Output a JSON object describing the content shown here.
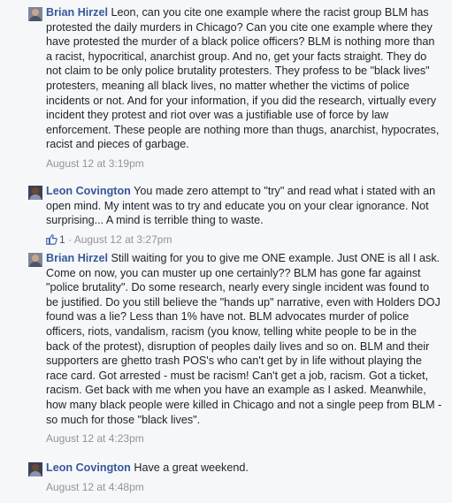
{
  "comments": [
    {
      "author": "Brian Hirzel",
      "text": "Leon, can you cite one example where the racist group BLM has protested the daily murders in Chicago? Can you cite one example where they have protested the murder of a black police officers? BLM is nothing more than a racist, hypocritical, anarchist group. And no, get your facts straight. They do not claim to be only police brutality protesters. They profess to be \"black lives\" protesters, meaning all black lives, no matter whether the victims of police incidents or not. And for your information, if you did the research, virtually every incident they protest and riot over was a justifiable use of force by law enforcement. These people are nothing more than thugs, anarchist, hypocrates, racist and pieces of garbage.",
      "timestamp": "August 12 at 3:19pm"
    },
    {
      "author": "Leon Covington",
      "text": "You made zero attempt to \"try\" and read what i stated with an open mind. My intent was to try and educate you on your clear ignorance. Not surprising... A mind is terrible thing to waste.",
      "likes": "1",
      "separator": " · ",
      "timestamp": "August 12 at 3:27pm"
    },
    {
      "author": "Brian Hirzel",
      "text": "Still waiting for you to give me ONE example. Just ONE is all I ask. Come on now, you can muster up one certainly?? BLM has gone far against \"police brutality\". Do some research, nearly every single incident was found to be justified. Do you still believe the \"hands up\" narrative, even with Holders DOJ found was a lie? Less than 1% have not. BLM advocates murder of police officers, riots, vandalism, racism (you know, telling white people to be in the back of the protest), disruption of peoples daily lives and so on. BLM and their supporters are ghetto trash POS's who can't get by in life without playing the race card. Got arrested - must be racism! Can't get a job, racism. Got a ticket, racism. Get back with me when you have an example as I asked. Meanwhile, how many black people were killed in Chicago and not a single peep from BLM - so much for those \"black lives\".",
      "timestamp": "August 12 at 4:23pm"
    },
    {
      "author": "Leon Covington",
      "text": "Have a great weekend.",
      "timestamp": "August 12 at 4:48pm"
    }
  ],
  "colors": {
    "background": "#f6f7f9",
    "author_link": "#365899",
    "text": "#1d2129",
    "meta": "#90949c",
    "like_icon": "#4267b2"
  },
  "icons": {
    "like": "thumbs-up-icon",
    "avatar": "profile-avatar"
  }
}
